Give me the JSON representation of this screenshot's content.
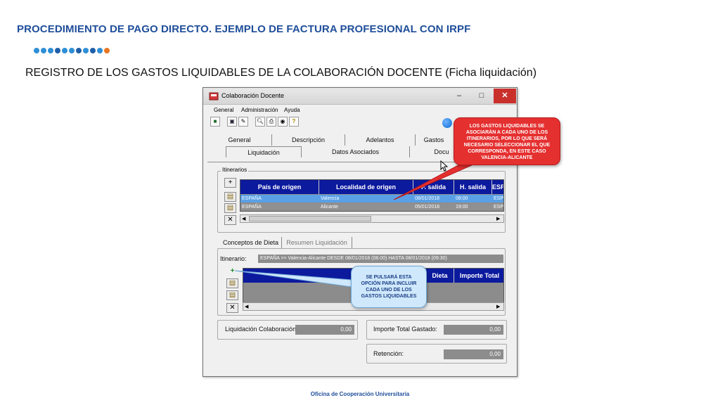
{
  "slide": {
    "title": "PROCEDIMIENTO DE PAGO DIRECTO. EJEMPLO DE FACTURA PROFESIONAL CON IRPF",
    "subtitle": "REGISTRO DE LOS GASTOS LIQUIDABLES DE LA COLABORACIÓN DOCENTE (Ficha liquidación)",
    "footer": "Oficina de Cooperación Universitaria",
    "dot_colors": [
      "#2e8fd6",
      "#2e8fd6",
      "#2e8fd6",
      "#1f5fa8",
      "#2e8fd6",
      "#2e8fd6",
      "#1f5fa8",
      "#2e8fd6",
      "#1f5fa8",
      "#2e8fd6",
      "#e87722"
    ]
  },
  "window": {
    "title": "Colaboración Docente",
    "min_icon": "minimize-icon",
    "max_icon": "maximize-icon",
    "close_icon": "close-icon"
  },
  "menu": [
    "General",
    "Administración",
    "Ayuda"
  ],
  "toolbar_icons": [
    "exit-icon",
    "save-icon",
    "edit-icon",
    "preview-icon",
    "print-icon",
    "binoculars-icon",
    "help-icon"
  ],
  "tabs_row1": [
    "General",
    "Descripción",
    "Adelantos",
    "Gastos"
  ],
  "tabs_row2": [
    "Liquidación",
    "Datos Asociados",
    "Docu"
  ],
  "itinerarios": {
    "label": "Itinerarios",
    "columns": [
      "País de origen",
      "Localidad de origen",
      "F. salida",
      "H. salida",
      "ESP"
    ],
    "rows": [
      [
        "ESPAÑA",
        "Valencia",
        "08/01/2018",
        "08:00",
        "ESP"
      ],
      [
        "ESPAÑA",
        "Alicante",
        "05/01/2018",
        "19:00",
        "ESP"
      ]
    ]
  },
  "subtabs": [
    "Conceptos de Dieta",
    "Resumen Liquidación"
  ],
  "itinerario": {
    "label": "Itinerario:",
    "value": "ESPAÑA >> Valencia-Alicante DESDE 08/01/2018 (08.00) HASTA 08/01/2018 (09:30)"
  },
  "conceptos": {
    "columns": [
      "",
      "Dieta",
      "Importe Total"
    ]
  },
  "totals": {
    "liquidacion_label": "Liquidación Colaboración",
    "liquidacion_value": "0,00",
    "importe_label": "Importe Total Gastado:",
    "importe_value": "0,00",
    "retencion_label": "Retención:",
    "retencion_value": "0,00"
  },
  "callouts": {
    "red": "LOS GASTOS LIQUIDABLES SE ASOCIARÁN A CADA UNO DE LOS ITINERARIOS, POR LO QUE SERÁ NECESARIO SELECCIONAR EL QUE CORRESPONDA, EN ESTE CASO VALENCIA-ALICANTE",
    "blue": "SE PULSARÁ ESTA OPCIÓN PARA INCLUIR CADA UNO DE LOS GASTOS LIQUIDABLES",
    "red_color": "#e53030",
    "blue_color": "#cfe8fb"
  }
}
